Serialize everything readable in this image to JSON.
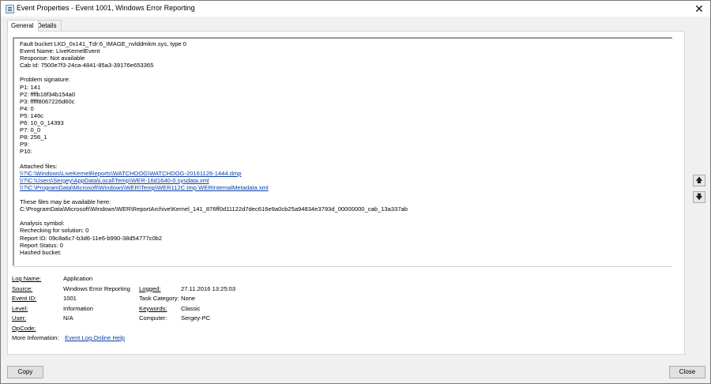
{
  "window": {
    "title": "Event Properties - Event 1001, Windows Error Reporting"
  },
  "tabs": [
    {
      "label": "General"
    },
    {
      "label": "Details"
    }
  ],
  "description": {
    "lines": [
      "Fault bucket LKD_0x141_Tdr:6_IMAGE_nvlddmkm.sys, type 0",
      "Event Name: LiveKernelEvent",
      "Response: Not available",
      "Cab Id: 7500e7f3-24ca-4841-85a3-39176e653365",
      "",
      "Problem signature:",
      "P1: 141",
      "P2: ffffb18f34b154a0",
      "P3: fffff8067226d60c",
      "P4: 0",
      "P5: 146c",
      "P6: 10_0_14393",
      "P7: 0_0",
      "P8: 256_1",
      "P9:",
      "P10:",
      "",
      "Attached files:"
    ],
    "attached_files": [
      "\\\\?\\C:\\Windows\\LiveKernelReports\\WATCHDOG\\WATCHDOG-20161126-1444.dmp",
      "\\\\?\\C:\\Users\\Sergey\\AppData\\Local\\Temp\\WER-16d1640-0.sysdata.xml",
      "\\\\?\\C:\\ProgramData\\Microsoft\\Windows\\WER\\Temp\\WER112C.tmp.WERInternalMetadata.xml"
    ],
    "after_lines": [
      "",
      "These files may be available here:",
      "C:\\ProgramData\\Microsoft\\Windows\\WER\\ReportArchive\\Kernel_141_876ff0d11122d7dec616e9a0cb25a94834e3793d_00000000_cab_13a337ab",
      "",
      "Analysis symbol:",
      "Rechecking for solution: 0",
      "Report ID: 09c8a6c7-b3d6-11e6-b990-38d54777c0b2",
      "Report Status: 0",
      "Hashed bucket:"
    ]
  },
  "info": {
    "log_name_label": "Log Name:",
    "log_name_value": "Application",
    "source_label": "Source:",
    "source_value": "Windows Error Reporting",
    "logged_label": "Logged:",
    "logged_value": "27.11.2016 13:25:03",
    "event_id_label": "Event ID:",
    "event_id_value": "1001",
    "task_category_label": "Task Category:",
    "task_category_value": "None",
    "level_label": "Level:",
    "level_value": "Information",
    "keywords_label": "Keywords:",
    "keywords_value": "Classic",
    "user_label": "User:",
    "user_value": "N/A",
    "computer_label": "Computer:",
    "computer_value": "Sergey-PC",
    "opcode_label": "OpCode:",
    "more_info_label": "More Information:",
    "more_info_link": "Event Log Online Help"
  },
  "buttons": {
    "copy": "Copy",
    "close": "Close"
  },
  "icons": {
    "title": "event-properties-icon",
    "close": "close-icon",
    "up": "arrow-up-icon",
    "down": "arrow-down-icon"
  }
}
